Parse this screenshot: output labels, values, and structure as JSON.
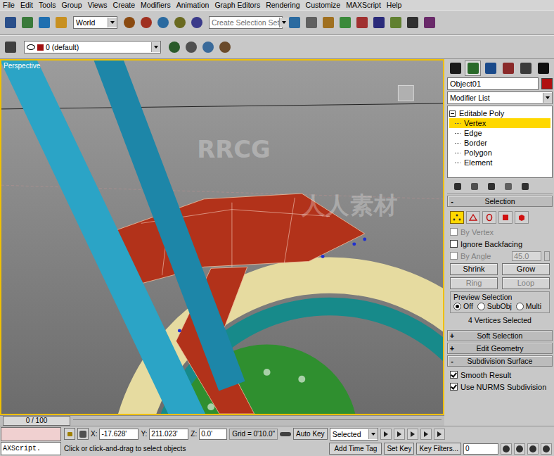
{
  "window": {
    "title": "3ds Max"
  },
  "menu": [
    "File",
    "Edit",
    "Tools",
    "Group",
    "Views",
    "Create",
    "Modifiers",
    "Animation",
    "Graph Editors",
    "Rendering",
    "Customize",
    "MAXScript",
    "Help"
  ],
  "toolbar": {
    "reference": "World",
    "selection_set": "Create Selection Set"
  },
  "layer": {
    "name": "0 (default)",
    "color": "#a01010"
  },
  "viewport": {
    "label": "Perspective",
    "watermarks": [
      "RRCG",
      "人人素材"
    ]
  },
  "command_panel": {
    "object_name": "Object01",
    "object_color": "#b01010",
    "modifier_list": "Modifier List",
    "stack": [
      {
        "label": "Editable Poly",
        "kind": "root",
        "expanded": true,
        "selected": false
      },
      {
        "label": "Vertex",
        "kind": "sub",
        "selected": true
      },
      {
        "label": "Edge",
        "kind": "sub",
        "selected": false
      },
      {
        "label": "Border",
        "kind": "sub",
        "selected": false
      },
      {
        "label": "Polygon",
        "kind": "sub",
        "selected": false
      },
      {
        "label": "Element",
        "kind": "sub",
        "selected": false
      }
    ],
    "selection": {
      "title": "Selection",
      "marker": "-",
      "subobjects": [
        {
          "kind": "vertex",
          "selected": true
        },
        {
          "kind": "edge",
          "selected": false
        },
        {
          "kind": "border",
          "selected": false
        },
        {
          "kind": "polygon",
          "selected": false
        },
        {
          "kind": "element",
          "selected": false
        }
      ],
      "checkboxes": [
        {
          "label": "By Vertex",
          "checked": false,
          "disabled": true
        },
        {
          "label": "Ignore Backfacing",
          "checked": false,
          "disabled": false
        }
      ],
      "by_angle": {
        "label": "By Angle",
        "value": "45.0",
        "checked": false,
        "disabled": true
      },
      "buttons": [
        {
          "label": "Shrink",
          "disabled": false
        },
        {
          "label": "Grow",
          "disabled": false
        },
        {
          "label": "Ring",
          "disabled": true
        },
        {
          "label": "Loop",
          "disabled": true
        }
      ],
      "preview": {
        "title": "Preview Selection",
        "options": [
          {
            "label": "Off",
            "selected": true
          },
          {
            "label": "SubObj",
            "selected": false
          },
          {
            "label": "Multi",
            "selected": false
          }
        ]
      },
      "status": "4 Vertices Selected"
    },
    "rollouts": [
      {
        "marker": "+",
        "title": "Soft Selection",
        "expanded": false
      },
      {
        "marker": "+",
        "title": "Edit Geometry",
        "expanded": false
      },
      {
        "marker": "-",
        "title": "Subdivision Surface",
        "expanded": true
      }
    ],
    "subdivision": [
      {
        "label": "Smooth Result",
        "checked": true
      },
      {
        "label": "Use NURMS Subdivision",
        "checked": true
      }
    ]
  },
  "timeline": {
    "frame": "0 / 100"
  },
  "status_bar": {
    "script": "AXScript.",
    "x_label": "X:",
    "x": "-17.628'",
    "y_label": "Y:",
    "y": "211.023'",
    "z_label": "Z:",
    "z": "0.0'",
    "grid": "Grid = 0'10.0\"",
    "auto_key": "Auto Key",
    "key_mode": "Selected",
    "set_key": "Set Key",
    "key_filters": "Key Filters...",
    "frame": "0",
    "prompt": "Click or click-and-drag to select objects",
    "time_tag": "Add Time Tag"
  }
}
